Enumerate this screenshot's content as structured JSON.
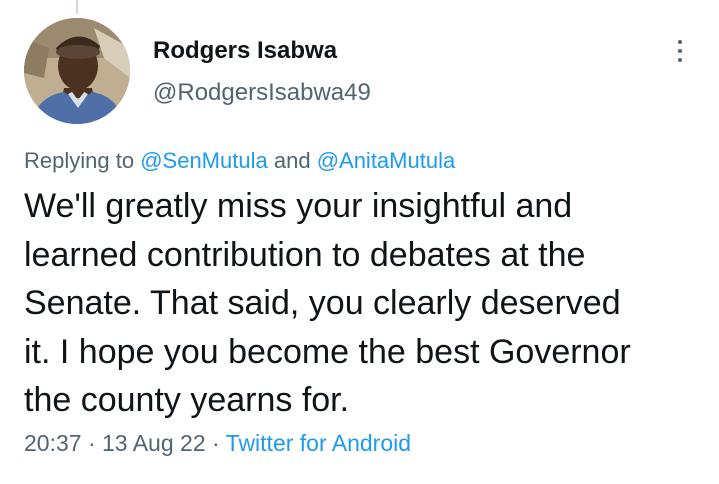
{
  "author": {
    "display_name": "Rodgers Isabwa",
    "handle": "@RodgersIsabwa49",
    "avatar_icon": "user-avatar-photo"
  },
  "reply_context": {
    "prefix": "Replying to",
    "mention_1": "@SenMutula",
    "conjunction": "and",
    "mention_2": "@AnitaMutula"
  },
  "tweet": {
    "lines": [
      "We'll greatly miss your insightful and",
      "learned contribution to debates at the",
      "Senate. That said, you clearly deserved",
      "it. I hope you become the best Governor",
      "the county yearns for."
    ]
  },
  "meta": {
    "time": "20:37",
    "separator": "·",
    "date": "13 Aug 22",
    "source": "Twitter for Android"
  },
  "icons": {
    "more": "more-options-icon"
  },
  "colors": {
    "text": "#0f1419",
    "secondary": "#536471",
    "link": "#1d9bf0"
  }
}
